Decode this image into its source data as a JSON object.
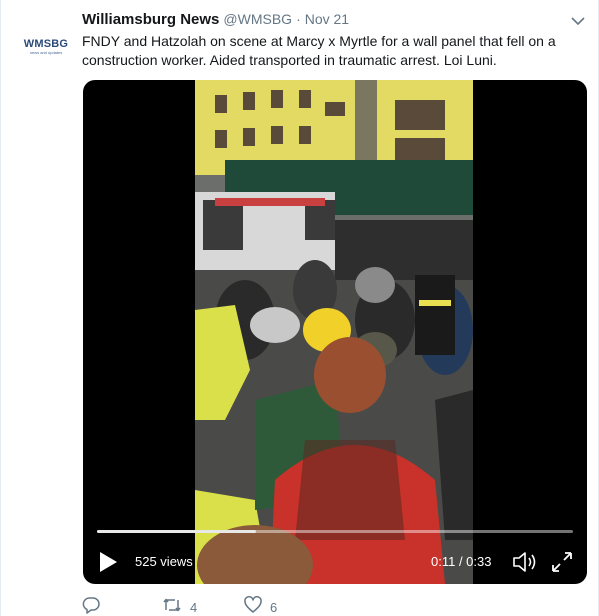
{
  "tweet": {
    "display_name": "Williamsburg News",
    "handle": "@WMSBG",
    "separator": "·",
    "date": "Nov 21",
    "text": "FNDY and Hatzolah on scene at Marcy x Myrtle for a wall panel that fell on a construction worker. Aided transported in traumatic arrest. Loi Luni."
  },
  "avatar": {
    "logo_text": "WMSBG",
    "logo_subtext": "news and updates"
  },
  "video": {
    "views": "525 views",
    "time": "0:11 / 0:33",
    "progress": 0.333
  },
  "actions": {
    "reply_count": "",
    "retweet_count": "4",
    "like_count": "6"
  },
  "colors": {
    "text_primary": "#14171a",
    "text_secondary": "#657786",
    "brand_logo": "#2b4a7a"
  },
  "icons": {
    "caret": "chevron-down-icon",
    "play": "play-icon",
    "volume": "volume-icon",
    "fullscreen": "fullscreen-icon",
    "reply": "reply-icon",
    "retweet": "retweet-icon",
    "like": "like-icon"
  }
}
